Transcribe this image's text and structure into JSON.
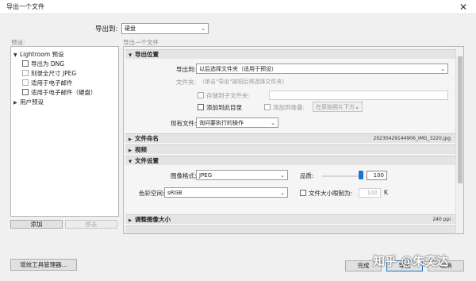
{
  "window": {
    "title": "导出一个文件",
    "close_glyph": "✕"
  },
  "destination": {
    "label": "导出到:",
    "value": "硬盘"
  },
  "presets": {
    "label": "预设:",
    "group": "Lightroom 预设",
    "items": [
      {
        "label": "导出为 DNG",
        "dim": false
      },
      {
        "label": "刻录全尺寸 JPEG",
        "dim": true
      },
      {
        "label": "适用于电子邮件",
        "dim": true
      },
      {
        "label": "适用于电子邮件（硬盘）",
        "dim": false
      }
    ],
    "user_group": "用户预设",
    "add_button": "添加",
    "remove_button": "移去"
  },
  "main": {
    "label": "导出一个文件",
    "sections": {
      "export_location": {
        "title": "导出位置",
        "export_to_label": "导出到:",
        "export_to_value": "以后选择文件夹（适用于预设）",
        "folder_label": "文件夹:",
        "folder_value": "（单击\"导出\"按钮后将选择文件夹）",
        "subfolder_label": "存储到子文件夹:",
        "add_to_catalog": "添加到此目录",
        "add_to_stack": "添加到堆叠:",
        "stack_value": "在原始照片下方",
        "existing_files_label": "现有文件:",
        "existing_files_value": "询问要执行的操作"
      },
      "file_naming": {
        "title": "文件命名",
        "filename": "20230429144906_IMG_3220.jpg"
      },
      "video": {
        "title": "视频"
      },
      "file_settings": {
        "title": "文件设置",
        "format_label": "图像格式:",
        "format_value": "JPEG",
        "quality_label": "品质:",
        "quality_value": "100",
        "quality_level": 1.0,
        "colorspace_label": "色彩空间:",
        "colorspace_value": "sRGB",
        "limit_size_label": "文件大小限制为:",
        "limit_size_value": "100",
        "limit_size_unit": "K"
      },
      "image_sizing": {
        "title": "调整图像大小",
        "resolution": "240 ppi"
      }
    }
  },
  "footer": {
    "plugin_manager": "增效工具管理器...",
    "done": "完成",
    "export": "导出",
    "cancel": "取消"
  },
  "watermark": "知乎 @朱奕达",
  "colors": {
    "accent": "#1e73d1",
    "window_bg": "#f0f0f0"
  }
}
